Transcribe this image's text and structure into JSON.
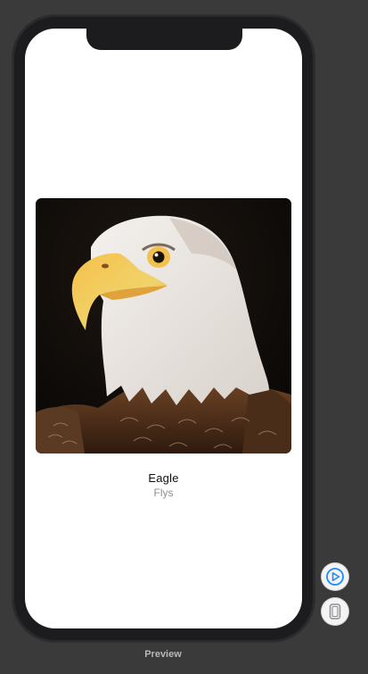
{
  "card": {
    "title": "Eagle",
    "subtitle": "Flys",
    "image": "bald-eagle-photo"
  },
  "controls": {
    "live_preview_icon": "play-circle-icon",
    "device_preview_icon": "device-icon",
    "accent": "#1a8cff"
  },
  "canvas": {
    "label": "Preview"
  }
}
